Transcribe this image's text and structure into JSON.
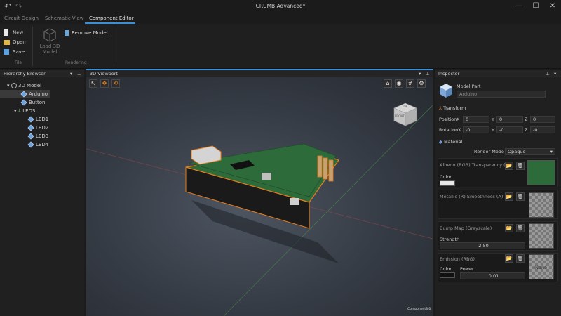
{
  "window": {
    "title": "CRUMB Advanced*"
  },
  "tabs": [
    {
      "label": "Circuit Design"
    },
    {
      "label": "Schematic View"
    },
    {
      "label": "Component Editor"
    }
  ],
  "ribbon": {
    "file": {
      "new": "New",
      "open": "Open",
      "save": "Save",
      "group": "File"
    },
    "load": {
      "line1": "Load 3D",
      "line2": "Model"
    },
    "remove": "Remove Model",
    "rendering_group": "Rendering"
  },
  "hierarchy": {
    "title": "Hierarchy Browser",
    "items": [
      {
        "label": "3D Model"
      },
      {
        "label": "Arduino"
      },
      {
        "label": "Button"
      },
      {
        "label": "LEDS"
      },
      {
        "label": "LED1"
      },
      {
        "label": "LED2"
      },
      {
        "label": "LED3"
      },
      {
        "label": "LED4"
      }
    ]
  },
  "viewport": {
    "title": "3D Viewport",
    "cube_top": "TOP",
    "cube_front": "FRONT",
    "status": "Component3.0"
  },
  "inspector": {
    "title": "Inspector",
    "part_label": "Model Part",
    "part_name": "Arduino",
    "transform": {
      "title": "Transform",
      "position_label": "Position",
      "rotation_label": "Rotation",
      "position": {
        "x": "0",
        "y": "0",
        "z": "0"
      },
      "rotation": {
        "x": "-0",
        "y": "-0",
        "z": "-0"
      }
    },
    "material": {
      "title": "Material",
      "render_mode_label": "Render Mode",
      "render_mode": "Opaque",
      "albedo": "Albedo (RGB) Transparency (A)",
      "color_label": "Color",
      "metallic": "Metallic (R) Smoothness (A)",
      "bump": "Bump Map (Grayscale)",
      "strength_label": "Strength",
      "strength": "2.50",
      "emission": "Emission (RBG)",
      "emission_color_label": "Color",
      "power_label": "Power",
      "power": "0.01",
      "none_label": "None"
    }
  },
  "colors": {
    "accent": "#3b8fd6",
    "selection_outline": "#e67c1a",
    "board": "#2e6b3a"
  }
}
